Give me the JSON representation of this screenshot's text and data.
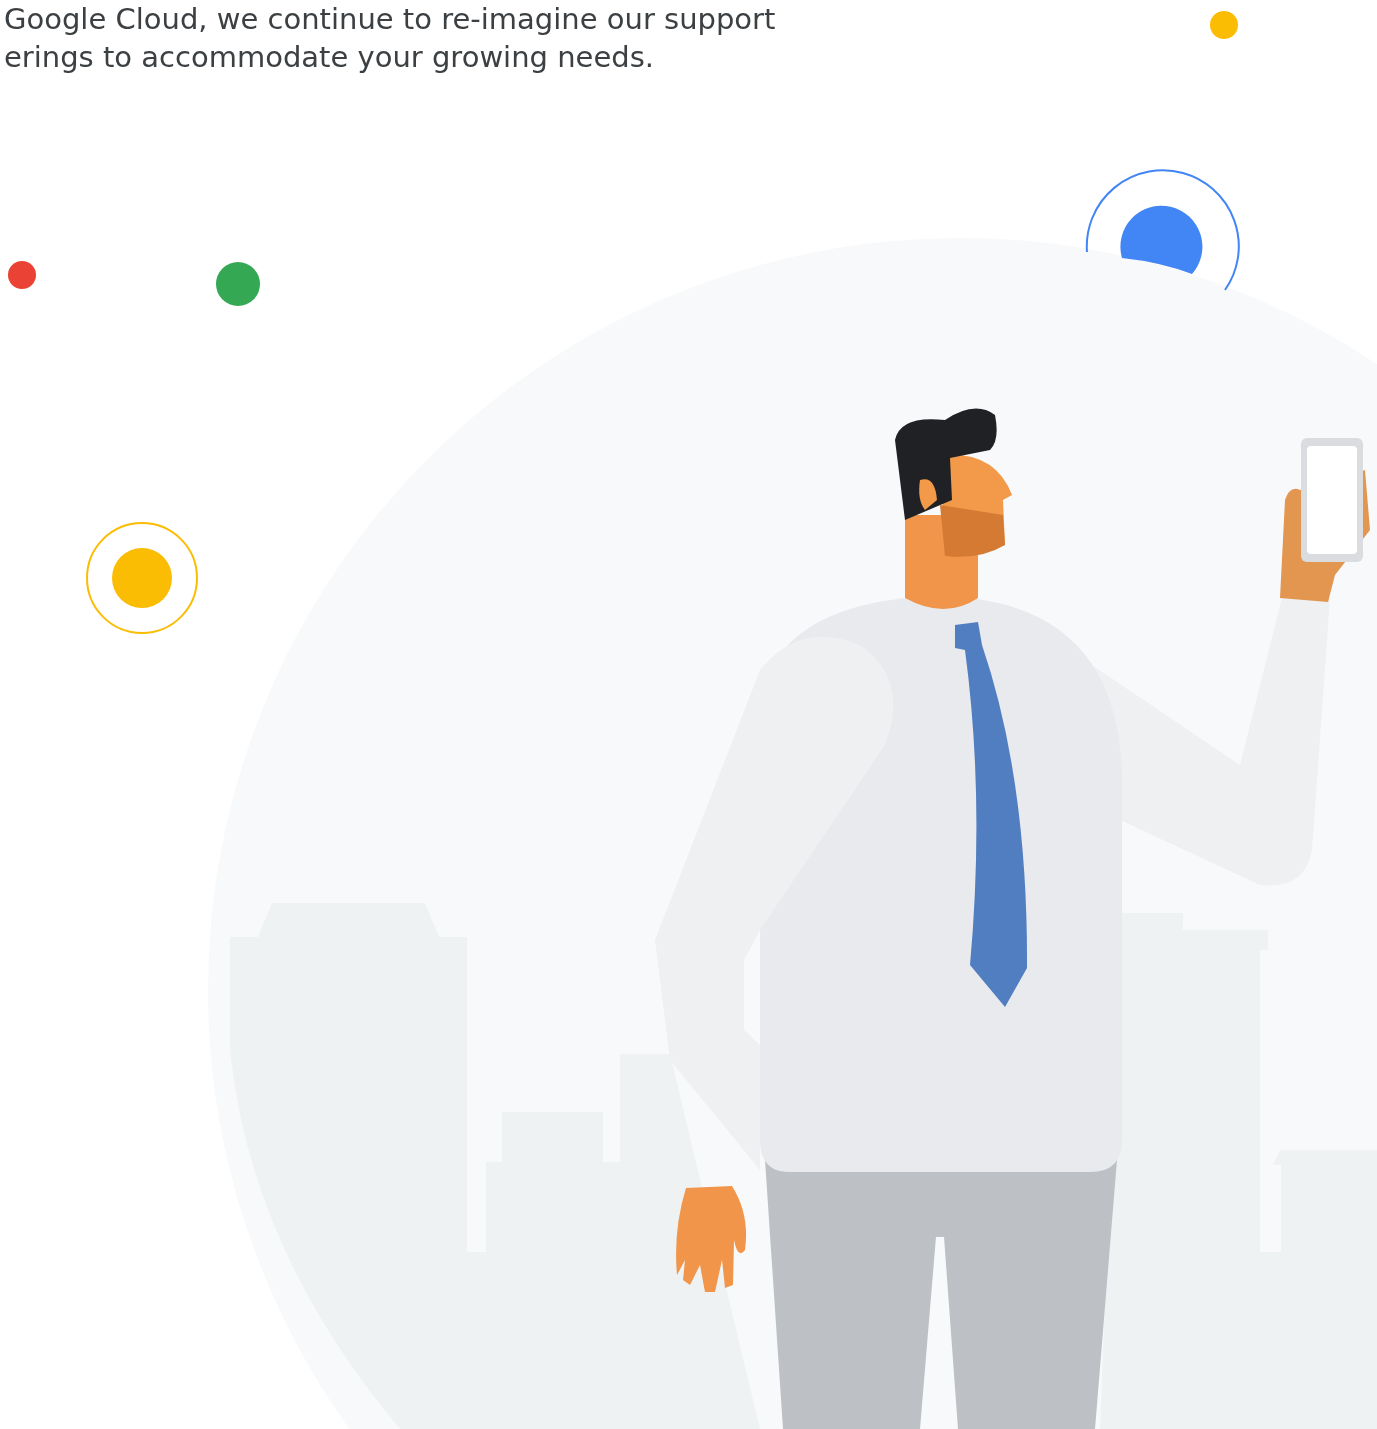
{
  "intro": {
    "lines": [
      "Google Cloud, we continue to re-imagine our support",
      "erings to accommodate your growing needs."
    ]
  }
}
